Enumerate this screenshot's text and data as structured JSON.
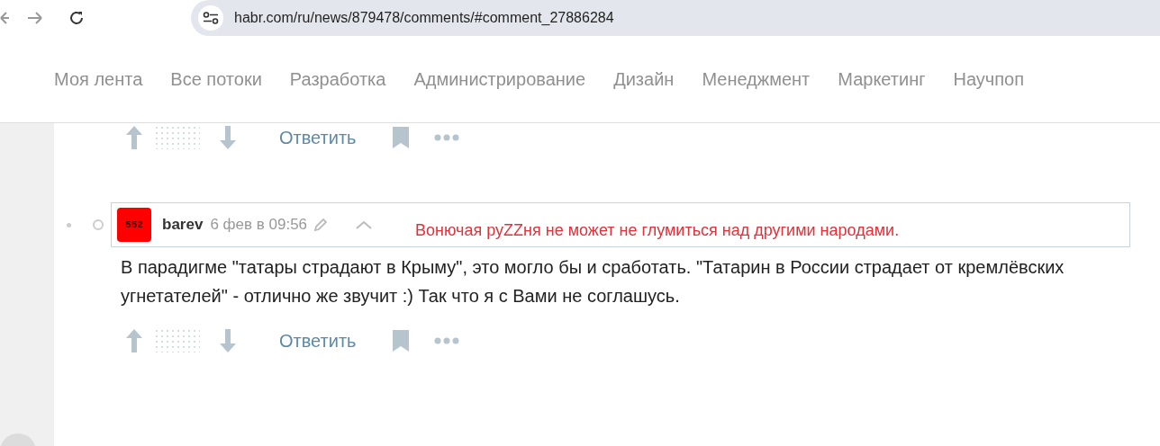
{
  "browser": {
    "url": "habr.com/ru/news/879478/comments/#comment_27886284"
  },
  "nav": {
    "items": [
      {
        "label": "Моя лента"
      },
      {
        "label": "Все потоки"
      },
      {
        "label": "Разработка"
      },
      {
        "label": "Администрирование"
      },
      {
        "label": "Дизайн"
      },
      {
        "label": "Менеджмент"
      },
      {
        "label": "Маркетинг"
      },
      {
        "label": "Научпоп"
      }
    ]
  },
  "prev_comment": {
    "reply": "Ответить"
  },
  "comment": {
    "avatar_text": "552",
    "author": "barev",
    "time": "6 фев в 09:56",
    "signature": "Вонючая руZZня не может не глумиться над другими народами.",
    "text": "В парадигме \"татары страдают в Крыму\", это могло бы и сработать. \"Татарин в России страдает от кремлёвских угнетателей\" - отлично же звучит :) Так что я с Вами не соглашусь.",
    "reply": "Ответить"
  }
}
